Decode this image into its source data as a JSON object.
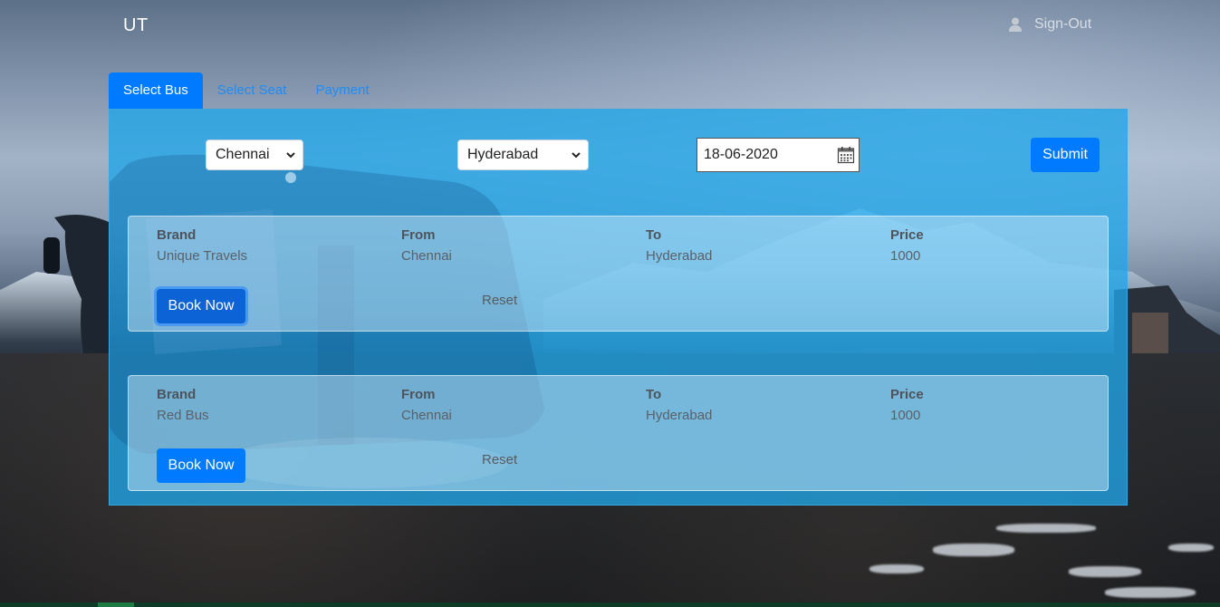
{
  "header": {
    "brand": "UT",
    "signout_label": "Sign-Out",
    "signout_icon": "user-icon"
  },
  "tabs": [
    {
      "label": "Select Bus",
      "active": true
    },
    {
      "label": "Select Seat",
      "active": false
    },
    {
      "label": "Payment",
      "active": false
    }
  ],
  "search": {
    "from_value": "Chennai",
    "to_value": "Hyderabad",
    "date_value": "18-06-2020",
    "submit_label": "Submit"
  },
  "columns": {
    "brand": "Brand",
    "from": "From",
    "to": "To",
    "price": "Price"
  },
  "results": [
    {
      "brand": "Unique Travels",
      "from": "Chennai",
      "to": "Hyderabad",
      "price": "1000",
      "book_label": "Book Now",
      "reset_label": "Reset"
    },
    {
      "brand": "Red Bus",
      "from": "Chennai",
      "to": "Hyderabad",
      "price": "1000",
      "book_label": "Book Now",
      "reset_label": "Reset"
    }
  ],
  "colors": {
    "primary": "#007bff",
    "panel": "#20a5e8",
    "link": "#1d8cf8"
  }
}
